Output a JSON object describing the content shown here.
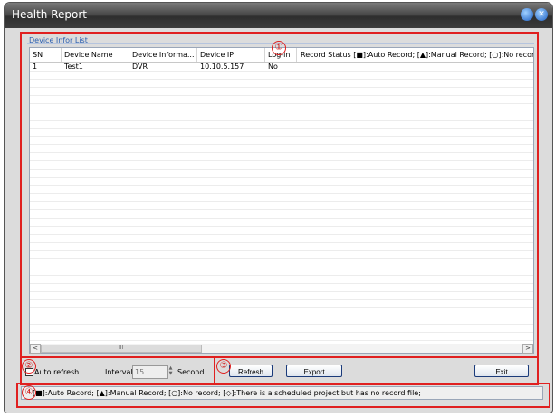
{
  "window": {
    "title": "Health Report"
  },
  "device_list": {
    "group_label": "Device Infor List",
    "columns": [
      "SN",
      "Device Name",
      "Device Informa...",
      "Device IP",
      "Log-in",
      "Record Status [■]:Auto Record; [▲]:Manual Record; [○]:No record"
    ],
    "rows": [
      [
        "1",
        "Test1",
        "DVR",
        "10.10.5.157",
        "No",
        ""
      ]
    ],
    "scroll_left": "<",
    "scroll_right": ">",
    "thumb_grip": "III"
  },
  "controls": {
    "auto_refresh_label": "Auto refresh",
    "interval_label": "Interval:",
    "interval_value": "15",
    "second_label": "Second",
    "refresh_button": "Refresh",
    "export_button": "Export",
    "exit_button": "Exit"
  },
  "status_bar": {
    "text": "[■]:Auto Record; [▲]:Manual Record; [○]:No record; [◇]:There is a scheduled project but has no record file;"
  },
  "callouts": {
    "n1": "①",
    "n2": "②",
    "n3": "③",
    "n4": "④"
  },
  "colors": {
    "callout": "#e02020",
    "titlebar": "#3c3c3c",
    "group_label": "#2a5fb0"
  }
}
